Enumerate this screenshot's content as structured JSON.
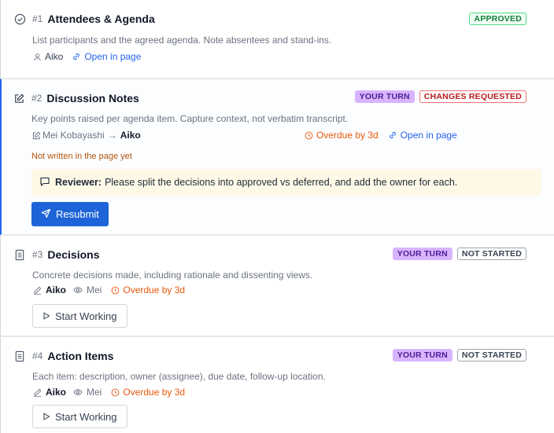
{
  "items": [
    {
      "number": "#1",
      "title": "Attendees & Agenda",
      "icon": "check-circle-icon",
      "badges": [
        "APPROVED"
      ],
      "description": "List participants and the agreed agenda. Note absentees and stand-ins.",
      "assignee": "Aiko",
      "open_link": "Open in page"
    },
    {
      "number": "#2",
      "title": "Discussion Notes",
      "icon": "edit-icon",
      "badges": [
        "YOUR TURN",
        "CHANGES REQUESTED"
      ],
      "description": "Key points raised per agenda item. Capture context, not verbatim transcript.",
      "writer": "Mei Kobayashi",
      "arrow": "→",
      "assignee": "Aiko",
      "overdue": "Overdue by 3d",
      "open_link": "Open in page",
      "notice": "Not written in the page yet",
      "review_label": "Reviewer:",
      "review_text": "Please split the decisions into approved vs deferred, and add the owner for each.",
      "action": "Resubmit"
    },
    {
      "number": "#3",
      "title": "Decisions",
      "icon": "document-icon",
      "badges": [
        "YOUR TURN",
        "NOT STARTED"
      ],
      "description": "Concrete decisions made, including rationale and dissenting views.",
      "writer": "Aiko",
      "reviewer": "Mei",
      "overdue": "Overdue by 3d",
      "action": "Start Working"
    },
    {
      "number": "#4",
      "title": "Action Items",
      "icon": "document-icon",
      "badges": [
        "YOUR TURN",
        "NOT STARTED"
      ],
      "description": "Each item: description, owner (assignee), due date, follow-up location.",
      "writer": "Aiko",
      "reviewer": "Mei",
      "overdue": "Overdue by 3d",
      "action": "Start Working"
    }
  ],
  "colors": {
    "accent": "#1d64d8",
    "your_turn_bg": "#d8b4fe",
    "approved": "#15803d",
    "changes": "#b91c1c",
    "overdue": "#ea580c",
    "review_bg": "#fef9e7"
  }
}
